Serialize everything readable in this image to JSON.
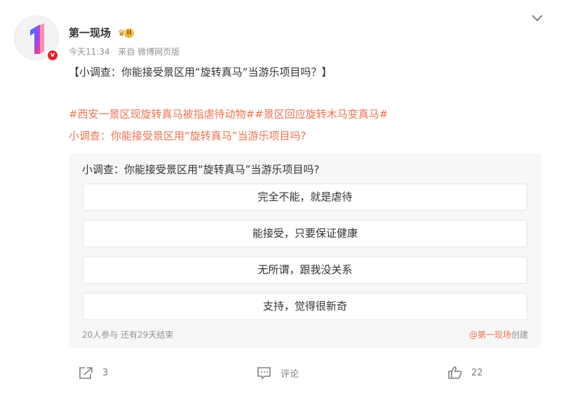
{
  "post": {
    "author": {
      "name": "第一现场",
      "avatar_glyph": "1",
      "verified_mark": "v",
      "level_label": "II",
      "level_icon": "crown-icon"
    },
    "meta": {
      "time": "今天11:34",
      "source": "来自 微博网页版"
    },
    "title": "【小调查：你能接受景区用“旋转真马”当游乐项目吗？】",
    "topics": "#西安一景区现旋转真马被指虐待动物##景区回应旋转木马变真马#",
    "topic_question": "小调查：你能接受景区用“旋转真马”当游乐项目吗?",
    "accent_color": "#eb7350"
  },
  "poll": {
    "question": "小调查：你能接受景区用“旋转真马”当游乐项目吗?",
    "options": [
      {
        "label": "完全不能，就是虐待"
      },
      {
        "label": "能接受，只要保证健康"
      },
      {
        "label": "无所谓，跟我没关系"
      },
      {
        "label": "支持，觉得很新奇"
      }
    ],
    "participants": "20人参与",
    "remaining": "还有29天结束",
    "creator": "@第一现场",
    "created_label": "创建"
  },
  "actions": {
    "share_count": "3",
    "comment_label": "评论",
    "like_count": "22"
  }
}
